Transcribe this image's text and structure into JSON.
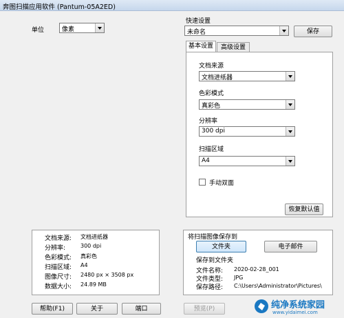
{
  "window": {
    "title": "奔图扫描应用软件 (Pantum-05A2ED)"
  },
  "unit": {
    "label": "单位",
    "value": "像素"
  },
  "quick": {
    "label": "快速设置",
    "value": "未命名",
    "save": "保存"
  },
  "tabs": {
    "basic": "基本设置",
    "advanced": "高级设置"
  },
  "basic": {
    "source_label": "文档来源",
    "source_value": "文档进纸器",
    "color_label": "色彩模式",
    "color_value": "真彩色",
    "res_label": "分辨率",
    "res_value": "300 dpi",
    "area_label": "扫描区域",
    "area_value": "A4",
    "duplex_label": "手动双面",
    "restore": "恢复默认值"
  },
  "summary": [
    {
      "k": "文档来源:",
      "v": "文档进纸器"
    },
    {
      "k": "分辨率:",
      "v": "300 dpi"
    },
    {
      "k": "色彩模式:",
      "v": "真彩色"
    },
    {
      "k": "扫描区域:",
      "v": "A4"
    },
    {
      "k": "图像尺寸:",
      "v": "2480 px × 3508 px"
    },
    {
      "k": "数据大小:",
      "v": "24.89 MB"
    }
  ],
  "saveto": {
    "title": "将扫描图像保存到",
    "folder_btn": "文件夹",
    "email_btn": "电子邮件",
    "sub": "保存到文件夹",
    "name_k": "文件名称:",
    "name_v": "2020-02-28_001",
    "type_k": "文件类型:",
    "type_v": "JPG",
    "path_k": "保存路径:",
    "path_v": "C:\\Users\\Administrator\\Pictures\\"
  },
  "buttons": {
    "help": "帮助(F1)",
    "about": "关于",
    "port": "端口",
    "preview": "预览(P)"
  },
  "watermark": {
    "text": "纯净系统家园",
    "url": "www.yidaimei.com"
  },
  "colors": {
    "accent": "#3c7fb1",
    "brand": "#1a78c2"
  }
}
